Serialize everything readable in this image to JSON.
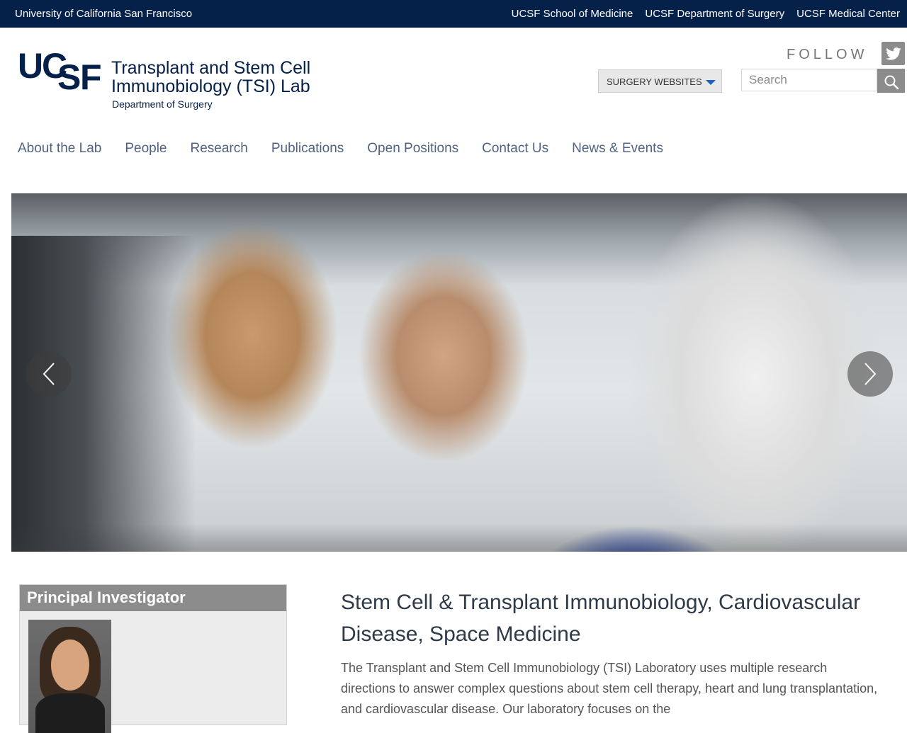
{
  "topbar": {
    "university": "University of California San Francisco",
    "links": [
      "UCSF School of Medicine",
      "UCSF Department of Surgery",
      "UCSF Medical Center"
    ]
  },
  "header": {
    "logo_text": "UCSF",
    "title_line1": "Transplant and Stem Cell",
    "title_line2": "Immunobiology (TSI) Lab",
    "subtitle": "Department of Surgery",
    "follow_label": "FOLLOW",
    "surgery_websites_label": "SURGERY WEBSITES",
    "search_placeholder": "Search"
  },
  "nav": {
    "items": [
      "About the Lab",
      "People",
      "Research",
      "Publications",
      "Open Positions",
      "Contact Us",
      "News & Events"
    ]
  },
  "icons": {
    "twitter": "twitter-icon",
    "search": "search-icon",
    "dropdown": "caret-down-icon",
    "prev": "chevron-left-icon",
    "next": "chevron-right-icon"
  },
  "sidebar": {
    "heading": "Principal Investigator"
  },
  "main": {
    "headline": "Stem Cell & Transplant Immunobiology, Cardiovascular Disease, Space Medicine",
    "intro": "The Transplant and Stem Cell Immunobiology (TSI) Laboratory uses multiple research directions to answer complex questions about stem cell therapy, heart and lung transplantation, and cardiovascular disease. Our laboratory focuses on the"
  },
  "colors": {
    "topbar_bg": "#052049",
    "brand_navy": "#052049",
    "nav_text": "#506380",
    "accent_blue": "#1d64c1",
    "grey_button": "#8c8c8c"
  }
}
